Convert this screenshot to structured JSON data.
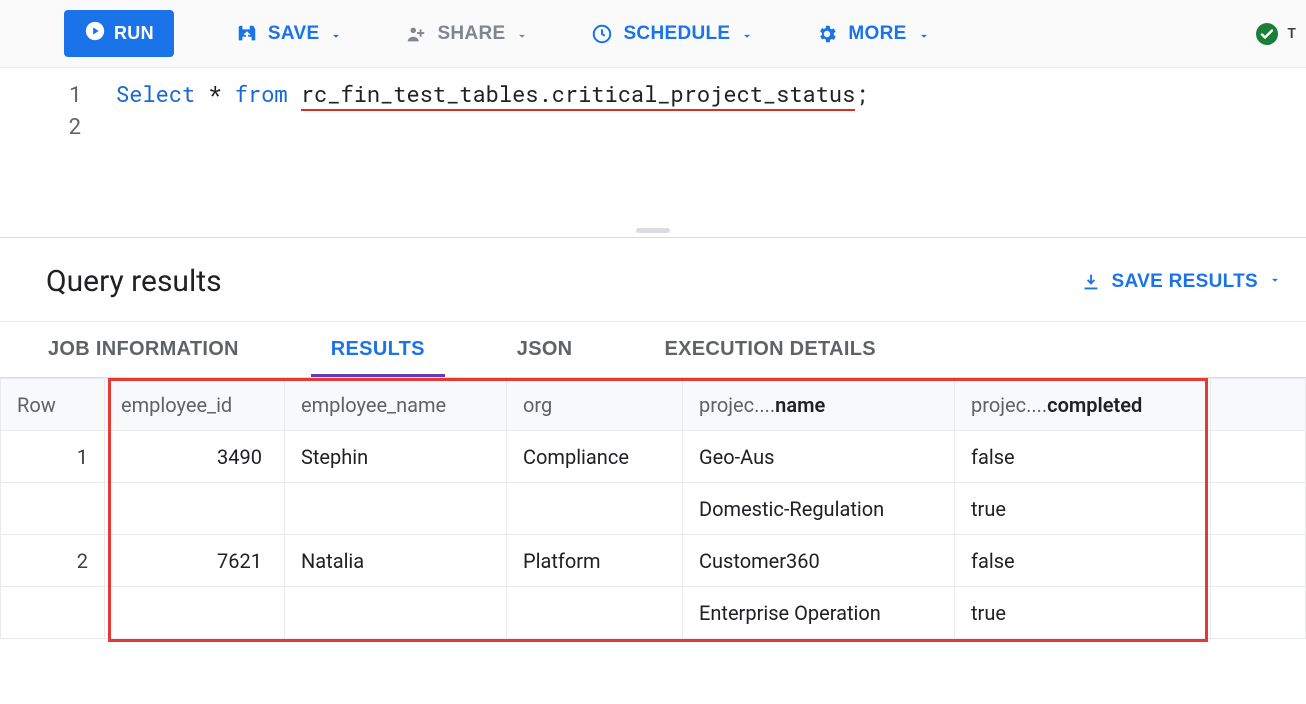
{
  "toolbar": {
    "run_label": "RUN",
    "save_label": "SAVE",
    "share_label": "SHARE",
    "schedule_label": "SCHEDULE",
    "more_label": "MORE",
    "status_text": "T"
  },
  "editor": {
    "line_numbers": [
      "1",
      "2"
    ],
    "line1_select": "Select",
    "line1_star": " * ",
    "line1_from": "from",
    "line1_gap": " ",
    "line1_table": "rc_fin_test_tables.critical_project_status",
    "line1_semi": ";"
  },
  "results_header": {
    "title": "Query results",
    "save_results_label": "SAVE RESULTS"
  },
  "tabs": {
    "job_info": "JOB INFORMATION",
    "results": "RESULTS",
    "json": "JSON",
    "exec": "EXECUTION DETAILS"
  },
  "table": {
    "columns": {
      "row": "Row",
      "employee_id": "employee_id",
      "employee_name": "employee_name",
      "org": "org",
      "project_name_prefix": "projec",
      "project_name_ell": "....",
      "project_name_suffix": "name",
      "project_completed_prefix": "projec",
      "project_completed_ell": "....",
      "project_completed_suffix": "completed"
    },
    "rows": [
      {
        "row": "1",
        "employee_id": "3490",
        "employee_name": "Stephin",
        "org": "Compliance",
        "projects": [
          {
            "name": "Geo-Aus",
            "completed": "false"
          },
          {
            "name": "Domestic-Regulation",
            "completed": "true"
          }
        ]
      },
      {
        "row": "2",
        "employee_id": "7621",
        "employee_name": "Natalia",
        "org": "Platform",
        "projects": [
          {
            "name": "Customer360",
            "completed": "false"
          },
          {
            "name": "Enterprise Operation",
            "completed": "true"
          }
        ]
      }
    ]
  }
}
